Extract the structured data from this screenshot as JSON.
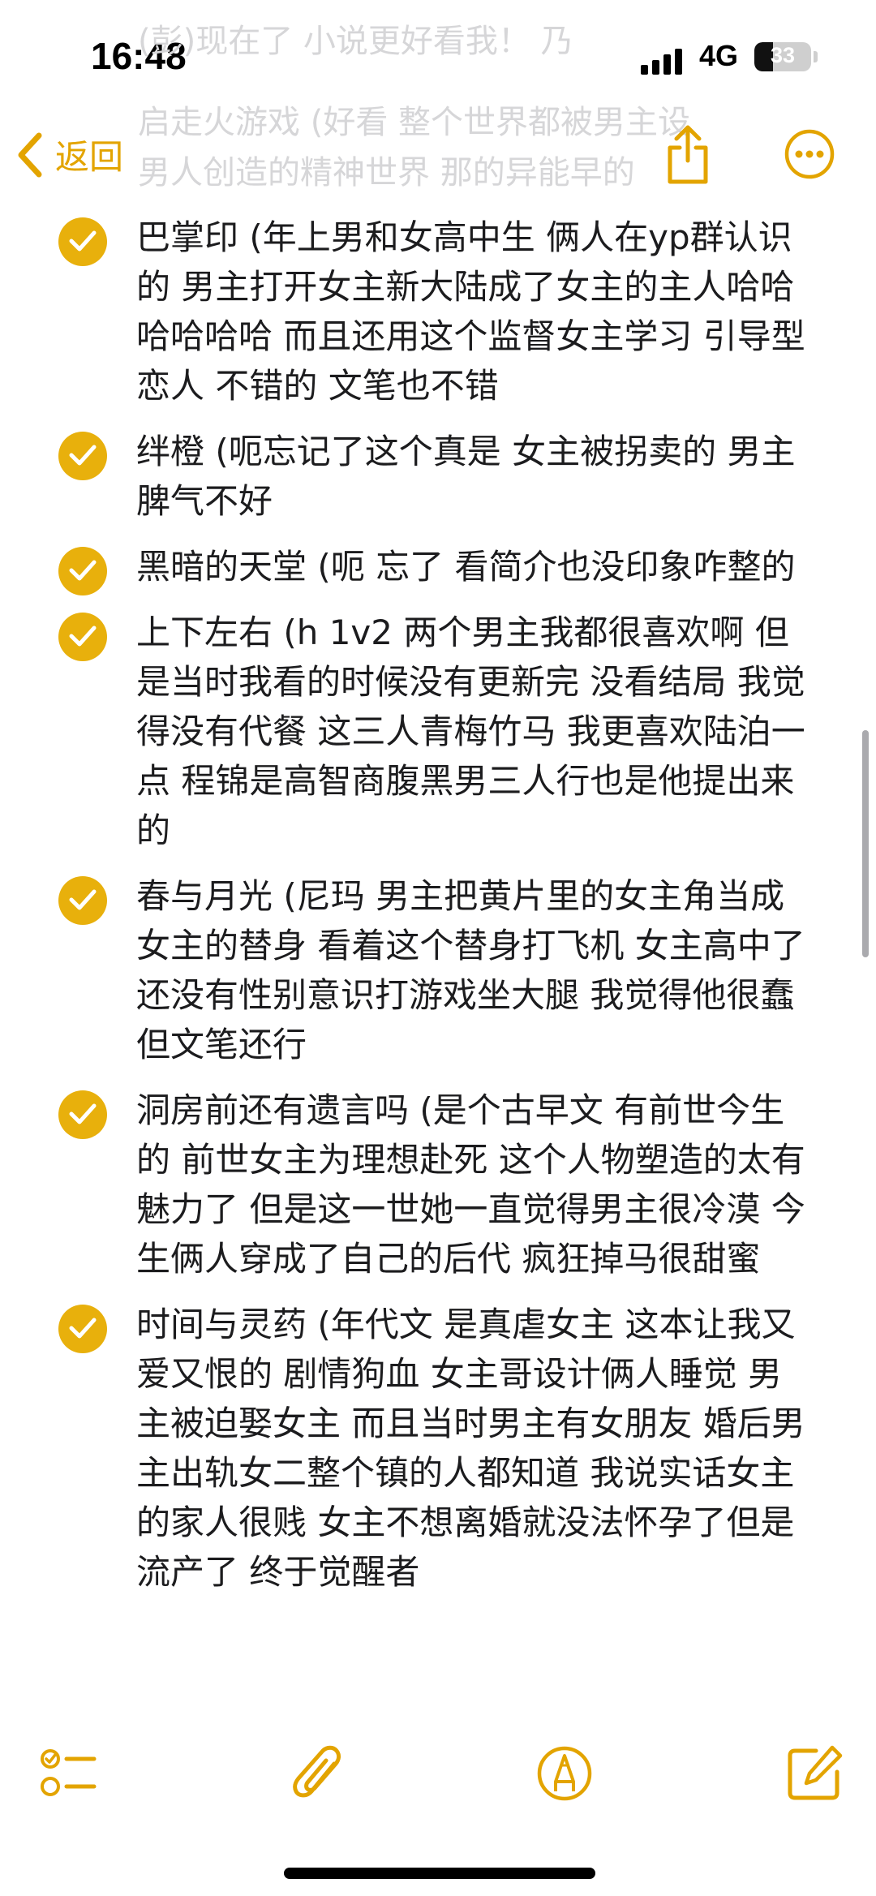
{
  "status_bar": {
    "time": "16:48",
    "network": "4G",
    "battery_percent": "33",
    "battery_level": 0.33
  },
  "nav": {
    "back_label": "返回",
    "accent_color": "#E3A400",
    "share_icon": "share-icon",
    "more_icon": "more-icon"
  },
  "ghost_lines": [
    "(彭)现在了 小说更好看我！ 乃",
    "启走火游戏 (好看 整个世界都被男主设",
    "男人创造的精神世界 那的异能早的"
  ],
  "items": [
    {
      "checked": true,
      "text": "巴掌印 (年上男和女高中生 俩人在yp群认识的 男主打开女主新大陆成了女主的主人哈哈哈哈哈哈 而且还用这个监督女主学习 引导型恋人 不错的 文笔也不错"
    },
    {
      "checked": true,
      "text": "绊橙 (呃忘记了这个真是 女主被拐卖的 男主脾气不好"
    },
    {
      "checked": true,
      "text": "黑暗的天堂 (呃 忘了 看简介也没印象咋整的"
    },
    {
      "checked": true,
      "text": "上下左右 (h 1v2 两个男主我都很喜欢啊 但是当时我看的时候没有更新完 没看结局 我觉得没有代餐 这三人青梅竹马 我更喜欢陆泊一点 程锦是高智商腹黑男三人行也是他提出来的"
    },
    {
      "checked": true,
      "text": "春与月光 (尼玛 男主把黄片里的女主角当成女主的替身 看着这个替身打飞机 女主高中了还没有性别意识打游戏坐大腿 我觉得他很蠢 但文笔还行"
    },
    {
      "checked": true,
      "text": "洞房前还有遗言吗 (是个古早文 有前世今生的 前世女主为理想赴死 这个人物塑造的太有魅力了 但是这一世她一直觉得男主很冷漠 今生俩人穿成了自己的后代 疯狂掉马很甜蜜"
    },
    {
      "checked": true,
      "text": "时间与灵药 (年代文 是真虐女主 这本让我又爱又恨的 剧情狗血 女主哥设计俩人睡觉 男主被迫娶女主 而且当时男主有女朋友 婚后男主出轨女二整个镇的人都知道 我说实话女主的家人很贱 女主不想离婚就没法怀孕了但是流产了 终于觉醒者"
    }
  ],
  "toolbar": {
    "checklist_icon": "checklist-icon",
    "attachment_icon": "paperclip-icon",
    "markup_icon": "markup-pen-icon",
    "compose_icon": "compose-icon"
  }
}
